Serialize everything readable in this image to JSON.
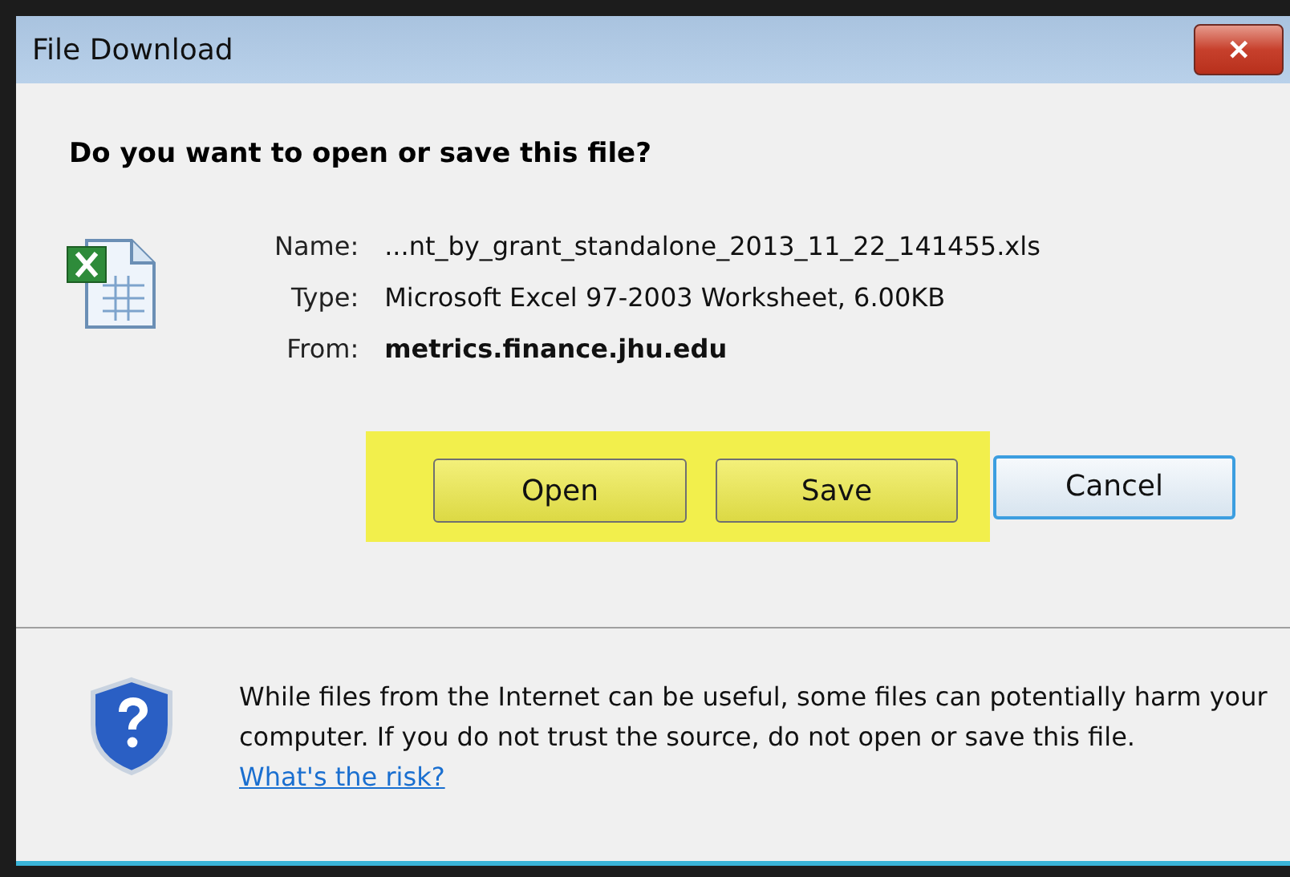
{
  "window": {
    "title": "File Download",
    "close_symbol": "✕"
  },
  "heading": "Do you want to open or save this file?",
  "details": [
    {
      "label": "Name:",
      "value": "...nt_by_grant_standalone_2013_11_22_141455.xls",
      "bold": false
    },
    {
      "label": "Type:",
      "value": "Microsoft Excel 97-2003 Worksheet, 6.00KB",
      "bold": false
    },
    {
      "label": "From:",
      "value": "metrics.finance.jhu.edu",
      "bold": true
    }
  ],
  "buttons": [
    {
      "label": "Open",
      "highlighted": true,
      "focused": false
    },
    {
      "label": "Save",
      "highlighted": true,
      "focused": false
    },
    {
      "label": "Cancel",
      "highlighted": false,
      "focused": true
    }
  ],
  "warning": {
    "text": "While files from the Internet can be useful, some files can potentially harm your computer. If you do not trust the source, do not open or save this file.",
    "link": "What's the risk?"
  }
}
